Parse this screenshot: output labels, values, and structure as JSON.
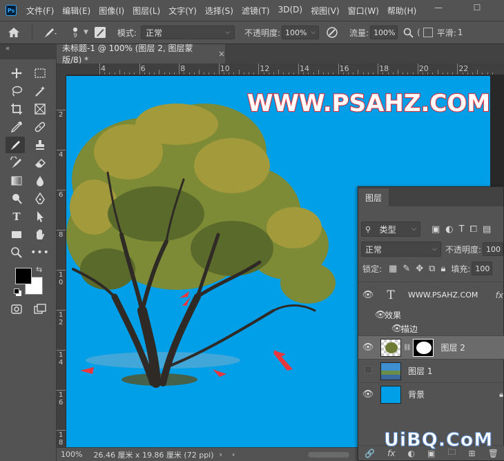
{
  "app": {
    "logo_text": "Ps"
  },
  "menu": [
    "文件(F)",
    "编辑(E)",
    "图像(I)",
    "图层(L)",
    "文字(Y)",
    "选择(S)",
    "滤镜(T)",
    "3D(D)",
    "视图(V)",
    "窗口(W)",
    "帮助(H)"
  ],
  "window_controls": {
    "minimize": "—",
    "maximize": "☐"
  },
  "options": {
    "brush_size": "9",
    "mode_label": "模式:",
    "mode_value": "正常",
    "opacity_label": "不透明度:",
    "opacity_value": "100%",
    "flow_label": "流量:",
    "flow_value": "100%",
    "smoothing_label": "平滑:",
    "smoothing_value": "1"
  },
  "collapse_glyph": "«",
  "document": {
    "tab_title": "未标题-1 @ 100% (图层 2, 图层蒙版/8) *",
    "close": "×",
    "watermark": "WWW.PSAHZ.COM"
  },
  "ruler_h_labels": [
    "4",
    "6",
    "8",
    "10",
    "12",
    "14",
    "16",
    "18",
    "20",
    "22"
  ],
  "ruler_v_labels": [
    "2",
    "4",
    "6",
    "8",
    "1\n0",
    "1\n2",
    "1\n4",
    "1\n6",
    "1\n8"
  ],
  "status": {
    "zoom": "100%",
    "doc_size": "26.46 厘米 x 19.86 厘米 (72 ppi)",
    "arrow": "›",
    "scroll_left": "‹"
  },
  "layers_panel": {
    "tab": "图层",
    "filter_label": "类型",
    "blend_mode": "正常",
    "opacity_label": "不透明度:",
    "opacity_value": "100",
    "lock_label": "锁定:",
    "fill_label": "填充:",
    "fill_value": "100",
    "layers": [
      {
        "name": "WWW.PSAHZ.COM",
        "type": "text",
        "type_glyph": "T",
        "fx": "fx",
        "visible": true
      },
      {
        "name": "效果",
        "type": "effect-group",
        "visible": true
      },
      {
        "name": "描边",
        "type": "effect",
        "visible": true
      },
      {
        "name": "图层 2",
        "type": "pixel-masked",
        "visible": true,
        "selected": true
      },
      {
        "name": "图层 1",
        "type": "pixel",
        "visible": false
      },
      {
        "name": "背景",
        "type": "background",
        "visible": true,
        "locked": true
      }
    ],
    "footer": [
      "🔗",
      "fx",
      "◐",
      "▣",
      "🗀",
      "⊞",
      "🗑"
    ]
  },
  "site_mark": "UiBQ.CoM",
  "colors": {
    "canvas_bg": "#009fe8",
    "watermark_stroke": "#e12d3a",
    "ui_bg": "#535353",
    "foreground": "#000000",
    "background": "#ffffff"
  }
}
